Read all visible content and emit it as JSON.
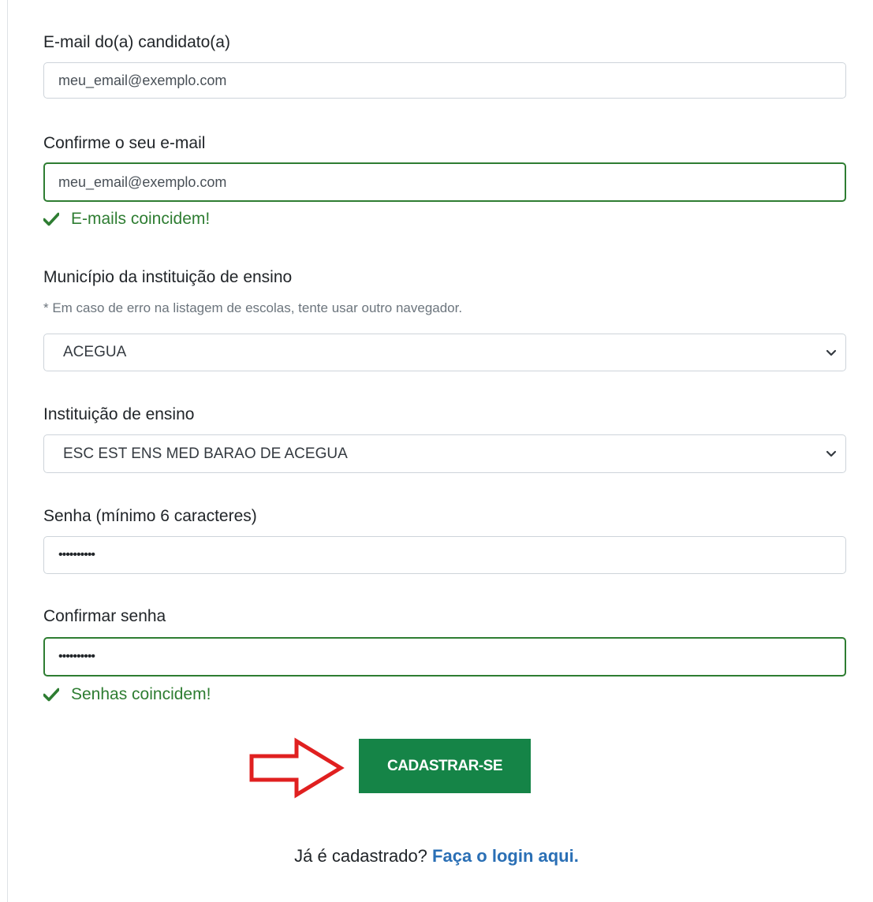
{
  "form": {
    "email": {
      "label": "E-mail do(a) candidato(a)",
      "value": "meu_email@exemplo.com"
    },
    "email_confirm": {
      "label": "Confirme o seu e-mail",
      "value": "meu_email@exemplo.com",
      "feedback": "E-mails coincidem!"
    },
    "municipality": {
      "label": "Município da instituição de ensino",
      "hint": "* Em caso de erro na listagem de escolas, tente usar outro navegador.",
      "selected": "ACEGUA"
    },
    "institution": {
      "label": "Instituição de ensino",
      "selected": "ESC EST ENS MED BARAO DE ACEGUA"
    },
    "password": {
      "label": "Senha (mínimo 6 caracteres)",
      "masked_value": "••••••••••"
    },
    "password_confirm": {
      "label": "Confirmar senha",
      "masked_value": "••••••••••",
      "feedback": "Senhas coincidem!"
    },
    "submit_label": "CADASTRAR-SE"
  },
  "footer": {
    "question": "Já é cadastrado?",
    "login_link": "Faça o login aqui."
  },
  "colors": {
    "success": "#2e7d32",
    "button": "#158447",
    "link": "#2a6fb5",
    "annotation_arrow": "#e02020"
  },
  "icons": {
    "valid_feedback": "check-icon",
    "select_indicator": "chevron-down-icon",
    "annotation": "right-arrow-icon"
  }
}
